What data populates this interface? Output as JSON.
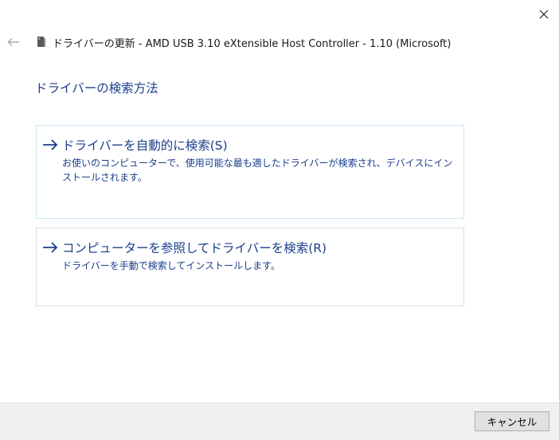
{
  "window": {
    "title": "ドライバーの更新 - AMD USB 3.10 eXtensible Host Controller - 1.10 (Microsoft)",
    "close_icon": "close-icon",
    "back_icon": "back-arrow-icon",
    "device_icon": "device-icon"
  },
  "page": {
    "heading": "ドライバーの検索方法"
  },
  "options": [
    {
      "title": "ドライバーを自動的に検索(S)",
      "description": "お使いのコンピューターで、使用可能な最も適したドライバーが検索され、デバイスにインストールされます。",
      "icon": "arrow-right-icon"
    },
    {
      "title": "コンピューターを参照してドライバーを検索(R)",
      "description": "ドライバーを手動で検索してインストールします。",
      "icon": "arrow-right-icon"
    }
  ],
  "footer": {
    "cancel_label": "キャンセル"
  },
  "colors": {
    "accent": "#1a3e8c",
    "footer_bg": "#f0f0f0",
    "card_border": "#dcdcdc"
  }
}
